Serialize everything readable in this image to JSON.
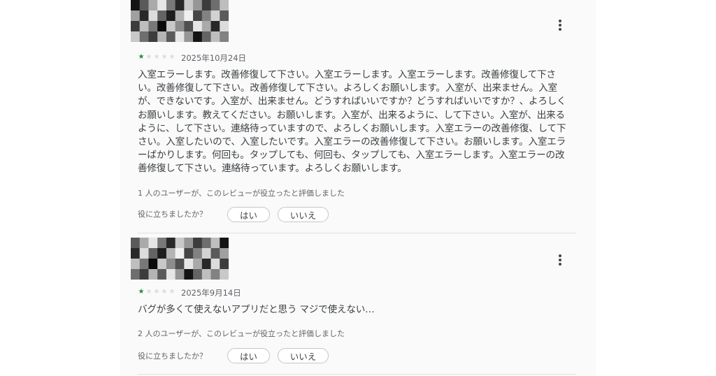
{
  "colors": {
    "star_filled": "#1e8e3e",
    "star_empty": "#dadce0",
    "text": "#3c4043",
    "muted": "#5f6368"
  },
  "reviews": [
    {
      "rating": 1,
      "max_rating": 5,
      "date": "2025年10月24日",
      "text": "入室エラーします。改善修復して下さい。入室エラーします。入室エラーします。改善修復して下さい。改善修復して下さい。改善修復して下さい。よろしくお願いします。入室が、出来ません。入室が、できないです。入室が、出来ません。どうすればいいですか？どうすればいいですか？、よろしくお願いします。教えてください。お願いします。入室が、出来るように、して下さい。入室が、出来るように、して下さい。連絡待っていますので、よろしくお願いします。入室エラーの改善修復、して下さい。入室したいので、入室したいです。入室エラーの改善修復して下さい。お願いします。入室エラーばかりします。何回も。タップしても、何回も、タップしても、入室エラーします。入室エラーの改善修復して下さい。連絡待っています。よろしくお願いします。",
      "helpful_count_text": "1 人のユーザーが、このレビューが役立ったと評価しました",
      "helpful_question": "役に立ちましたか？",
      "yes_label": "はい",
      "no_label": "いいえ"
    },
    {
      "rating": 1,
      "max_rating": 5,
      "date": "2025年9月14日",
      "text": "バグが多くて使えないアプリだと思う マジで使えない…",
      "helpful_count_text": "2 人のユーザーが、このレビューが役立ったと評価しました",
      "helpful_question": "役に立ちましたか？",
      "yes_label": "はい",
      "no_label": "いいえ"
    }
  ]
}
